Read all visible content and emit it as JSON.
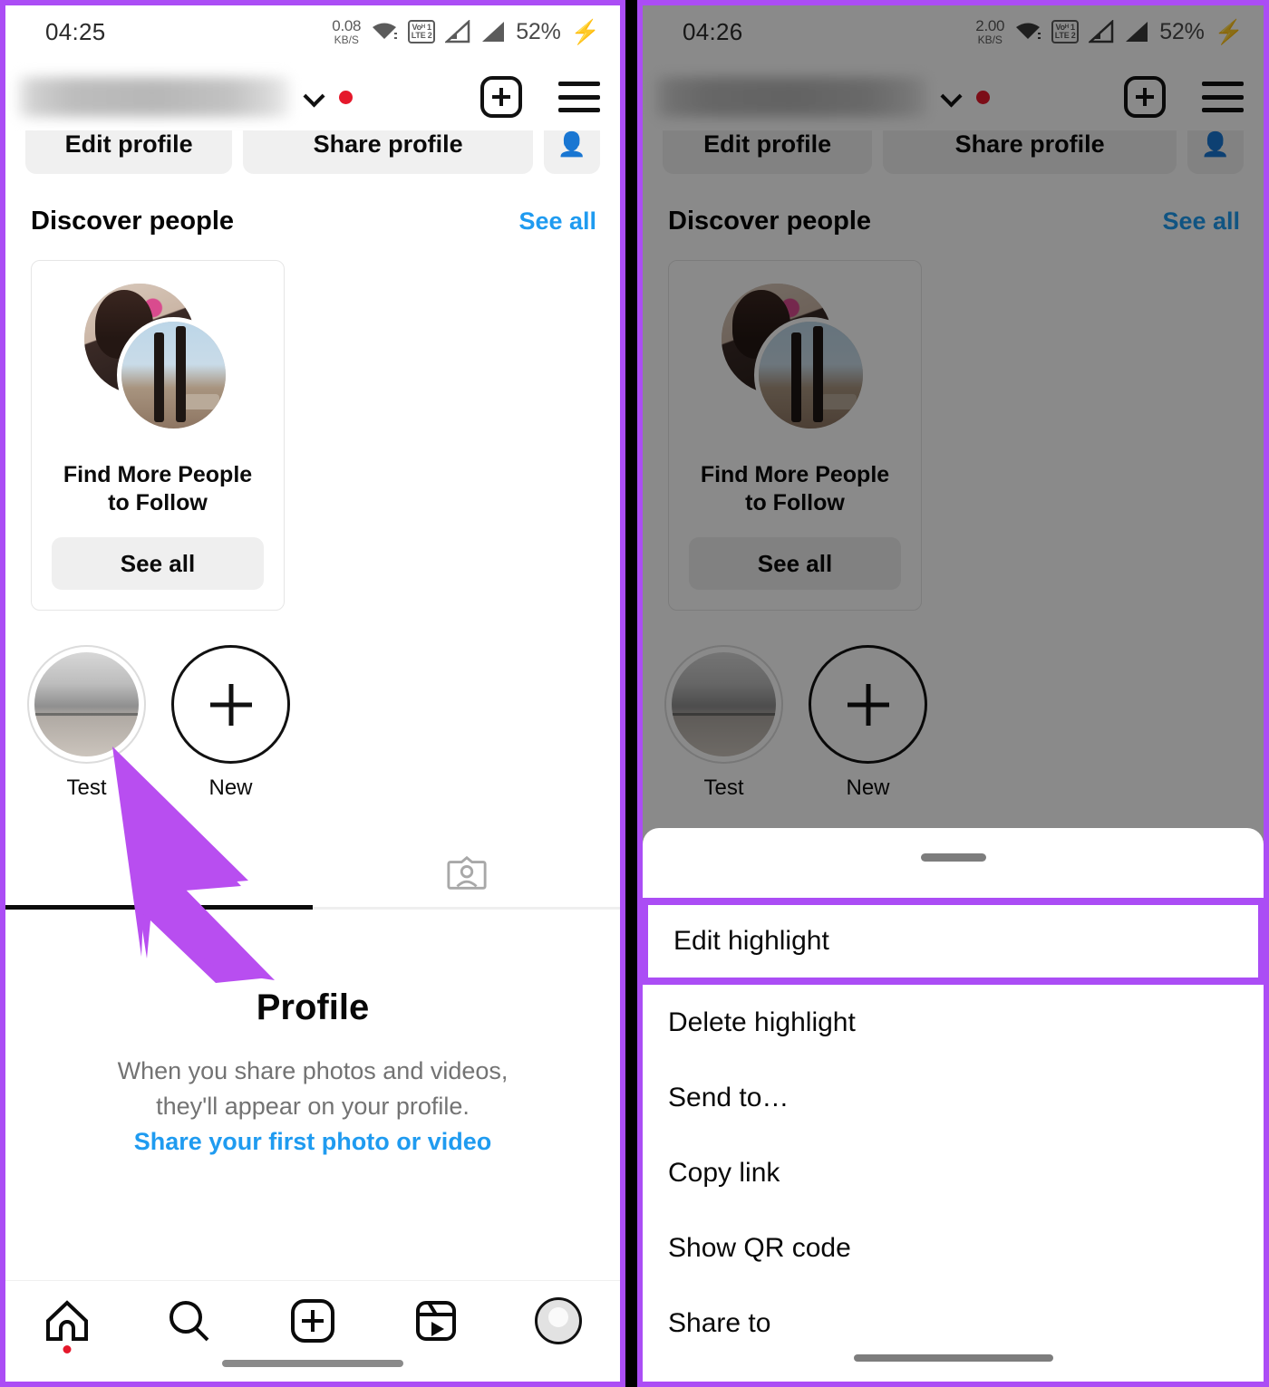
{
  "frame": {
    "accent_color": "#ab4df5",
    "background": "#000000"
  },
  "left": {
    "status_bar": {
      "time": "04:25",
      "data_rate_value": "0.08",
      "data_rate_unit": "KB/S",
      "network_line1": "Voᴴ 1",
      "network_line2": "LTE 2",
      "battery": "52%",
      "icons": [
        "wifi-icon",
        "volte-icon",
        "signal-bar-icon",
        "signal-bar-icon",
        "charging-bolt-icon"
      ]
    },
    "header": {
      "username_blurred": "",
      "chevron": "chevron-down-icon",
      "notification_dot": true,
      "create_label": "create-post-icon",
      "menu_label": "hamburger-menu-icon"
    },
    "actions": {
      "edit_profile": "Edit profile",
      "share_profile": "Share profile",
      "add_person": "add-person-icon"
    },
    "discover": {
      "title": "Discover people",
      "see_all": "See all",
      "card_title": "Find More People\nto Follow",
      "card_title_line1": "Find More People",
      "card_title_line2": "to Follow",
      "card_button": "See all"
    },
    "highlights": [
      {
        "label": "Test",
        "type": "story-highlight"
      },
      {
        "label": "New",
        "type": "new-highlight"
      }
    ],
    "tabs": [
      {
        "name": "grid-tab",
        "icon": "grid-icon",
        "active": true
      },
      {
        "name": "tagged-tab",
        "icon": "tagged-person-icon",
        "active": false
      }
    ],
    "empty_state": {
      "title": "Profile",
      "line1": "When you share photos and videos,",
      "line2": "they'll appear on your profile.",
      "link": "Share your first photo or video"
    },
    "bottom_nav": [
      {
        "name": "home-tab",
        "icon": "home-icon",
        "badge": true
      },
      {
        "name": "search-tab",
        "icon": "search-icon",
        "badge": false
      },
      {
        "name": "create-tab",
        "icon": "plus-box-icon",
        "badge": false
      },
      {
        "name": "reels-tab",
        "icon": "reels-icon",
        "badge": false
      },
      {
        "name": "profile-tab",
        "icon": "avatar-icon",
        "badge": false
      }
    ],
    "annotation": {
      "type": "pointer-arrow",
      "color": "#b84ef0",
      "points_to": "Test highlight"
    }
  },
  "right": {
    "status_bar": {
      "time": "04:26",
      "data_rate_value": "2.00",
      "data_rate_unit": "KB/S",
      "battery": "52%"
    },
    "header": {
      "username_blurred": "",
      "chevron": "chevron-down-icon",
      "notification_dot": true
    },
    "actions": {
      "edit_profile": "Edit profile",
      "share_profile": "Share profile",
      "add_person": "add-person-icon"
    },
    "discover": {
      "title": "Discover people",
      "see_all": "See all",
      "card_title_line1": "Find More People",
      "card_title_line2": "to Follow",
      "card_button": "See all"
    },
    "highlights": [
      {
        "label": "Test"
      },
      {
        "label": "New"
      }
    ],
    "sheet": {
      "handle": "drag-handle",
      "items": [
        {
          "label": "Edit highlight",
          "highlighted": true
        },
        {
          "label": "Delete highlight",
          "highlighted": false
        },
        {
          "label": "Send to…",
          "highlighted": false
        },
        {
          "label": "Copy link",
          "highlighted": false
        },
        {
          "label": "Show QR code",
          "highlighted": false
        },
        {
          "label": "Share to",
          "highlighted": false
        }
      ]
    }
  }
}
